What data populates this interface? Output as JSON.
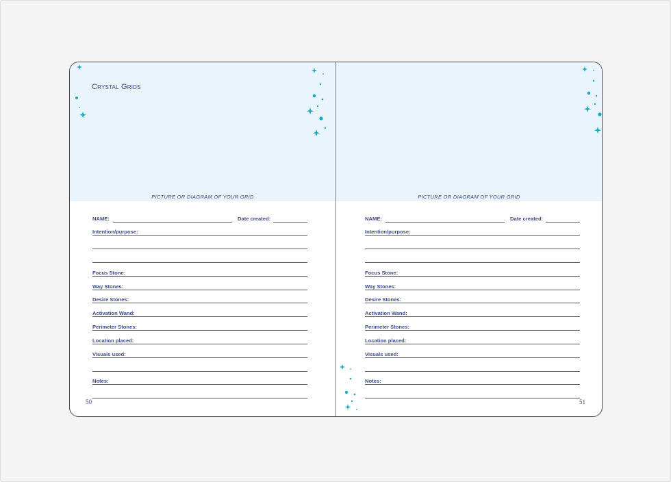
{
  "header": {
    "title": "Crystal Grids"
  },
  "left_page": {
    "caption": "PICTURE OR DIAGRAM OF YOUR GRID",
    "name_label": "NAME:",
    "date_label": "Date created:",
    "intention_label": "Intention/purpose:",
    "focus_label": "Focus Stone:",
    "way_label": "Way Stones:",
    "desire_label": "Desire Stones:",
    "wand_label": "Activation Wand:",
    "perimeter_label": "Perimeter Stones:",
    "location_label": "Location placed:",
    "visuals_label": "Visuals used:",
    "notes_label": "Notes:",
    "page_number": "50"
  },
  "right_page": {
    "caption": "PICTURE OR DIAGRAM OF YOUR GRID",
    "name_label": "NAME:",
    "date_label": "Date created:",
    "intention_label": "Intention/purpose:",
    "focus_label": "Focus Stone:",
    "way_label": "Way Stones:",
    "desire_label": "Desire Stones:",
    "wand_label": "Activation Wand:",
    "perimeter_label": "Perimeter Stones:",
    "location_label": "Location placed:",
    "visuals_label": "Visuals used:",
    "notes_label": "Notes:",
    "page_number": "51"
  },
  "colors": {
    "accent": "#14a9c2",
    "text": "#3b4a8a",
    "panel": "#eaf4fd"
  },
  "icons": [
    "moon-icon",
    "sparkle-icon",
    "dot-icon"
  ]
}
